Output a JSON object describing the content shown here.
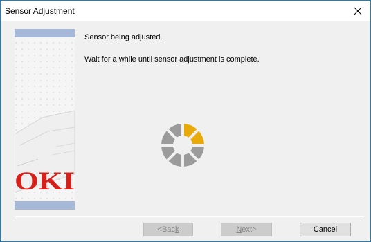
{
  "window": {
    "title": "Sensor Adjustment",
    "close_glyph": "✕"
  },
  "side_panel": {
    "logo_text": "OKI",
    "accent_color": "#a6b8d8",
    "logo_color": "#d8201b"
  },
  "messages": {
    "status": "Sensor being adjusted.",
    "instruction": "Wait for a while until sensor adjustment is complete."
  },
  "spinner": {
    "icon": "progress-spinner-icon",
    "segment_count": 8,
    "highlighted_segments": 2,
    "highlight_color": "#e8a90b",
    "segment_color": "#9b9b9b"
  },
  "buttons": {
    "back": {
      "prefix": "<Bac",
      "underlined": "k",
      "suffix": "",
      "enabled": false
    },
    "next": {
      "prefix": "",
      "underlined": "N",
      "suffix": "ext>",
      "enabled": false
    },
    "cancel": {
      "label": "Cancel",
      "enabled": true
    }
  }
}
